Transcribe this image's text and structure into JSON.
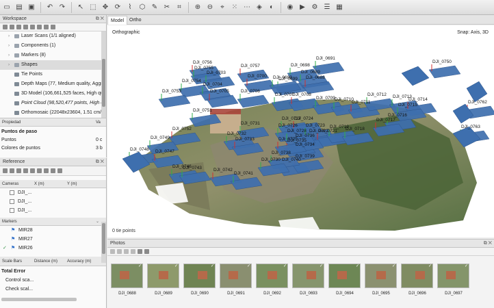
{
  "workspace": {
    "title": "Workspace",
    "tree": [
      {
        "label": "Laser Scans (1/1 aligned)",
        "indent": 0,
        "expandable": true
      },
      {
        "label": "Components (1)",
        "indent": 0,
        "expandable": true
      },
      {
        "label": "Markers (8)",
        "indent": 0,
        "expandable": true
      },
      {
        "label": "Shapes",
        "indent": 0,
        "expandable": true
      },
      {
        "label": "Tie Points",
        "indent": 1,
        "expandable": false
      },
      {
        "label": "Depth Maps (77, Medium quality, Aggres",
        "indent": 1,
        "expandable": false
      },
      {
        "label": "3D Model (106,661,525 faces, High quali",
        "indent": 1,
        "expandable": false
      },
      {
        "label": "Point Cloud (98,520,477 points, High qua",
        "indent": 1,
        "expandable": false
      },
      {
        "label": "Orthomosaic (22048x23604, 1.51 cm/pix",
        "indent": 1,
        "expandable": false
      }
    ]
  },
  "properties": {
    "col_name": "Propiedad",
    "col_value": "Va",
    "section": "Puntos de paso",
    "rows": [
      {
        "name": "Puntos",
        "value": "0 c"
      },
      {
        "name": "Colores de puntos",
        "value": "3 b"
      }
    ]
  },
  "reference": {
    "title": "Reference",
    "cam_columns": [
      "Cameras",
      "X (m)",
      "Y (m)"
    ],
    "cameras": [
      "DJI_...",
      "DJI_...",
      "DJI_..."
    ],
    "markers_header": "Markers",
    "markers": [
      {
        "name": "MIR28",
        "checked": false
      },
      {
        "name": "MIR27",
        "checked": false
      },
      {
        "name": "MIR26",
        "checked": true
      }
    ],
    "scalebar_columns": [
      "Scale Bars",
      "Distance (m)",
      "Accuracy (m)",
      "Er"
    ],
    "total_error": "Total Error",
    "error_rows": [
      "Control sca...",
      "Check scal..."
    ]
  },
  "view": {
    "tabs": [
      "Model",
      "Ortho"
    ],
    "active_tab": "Model",
    "projection": "Orthographic",
    "snap": "Snap: Axis, 3D",
    "status": "0 tie points"
  },
  "scene_labels": [
    "DJI_0756",
    "DJI_0755",
    "DJI_0703",
    "DJI_0757",
    "DJI_0698",
    "DJI_0691",
    "DJI_0750",
    "DJI_0754",
    "DJI_0704",
    "DJI_0700",
    "DJI_0699",
    "DJI_0689",
    "DJI_0688",
    "DJI_0690",
    "DJI_0753",
    "DJI_0705",
    "DJI_0706",
    "DJI_0707",
    "DJI_0708",
    "DJI_0709",
    "DJI_0710",
    "DJI_0711",
    "DJI_0712",
    "DJI_0713",
    "DJI_0714",
    "DJI_0715",
    "DJI_0716",
    "DJI_0762",
    "DJI_0727",
    "DJI_0726",
    "DJI_0724",
    "DJI_0723",
    "DJI_0722",
    "DJI_0721",
    "DJI_0719",
    "DJI_0718",
    "DJI_0717",
    "DJI_0763",
    "DJI_0751",
    "DJI_0752",
    "DJI_0731",
    "DJI_0732",
    "DJI_0733",
    "DJI_0749",
    "DJI_0748",
    "DJI_0747",
    "DJI_0746",
    "DJI_0743",
    "DJI_0742",
    "DJI_0741",
    "DJI_0740",
    "DJI_0739",
    "DJI_0738",
    "DJI_0734",
    "DJI_0735",
    "DJI_0736",
    "DJI_0728",
    "DJI_0725",
    "DJI_0730"
  ],
  "photos": {
    "title": "Photos",
    "items": [
      "DJI_0688",
      "DJI_0689",
      "DJI_0690",
      "DJI_0691",
      "DJI_0692",
      "DJI_0693",
      "DJI_0694",
      "DJI_0695",
      "DJI_0696",
      "DJI_0697"
    ]
  },
  "colors": {
    "camera_plane": "#3e6fae",
    "accent": "#2e6bd0",
    "flag": "#2f6fc9"
  },
  "toolbar_icons": [
    "new-icon",
    "open-icon",
    "save-icon",
    "undo-icon",
    "redo-icon",
    "pointer-icon",
    "select-rect-icon",
    "move-icon",
    "rotate-icon",
    "draw-polyline-icon",
    "draw-polygon-icon",
    "ruler-icon",
    "cut-icon",
    "crop-icon",
    "zoom-in-icon",
    "zoom-out-icon",
    "navigate-icon",
    "grid-icon",
    "points-icon",
    "model-icon",
    "shaded-icon",
    "camera-icon",
    "video-icon",
    "settings-icon",
    "menu-icon",
    "map-icon"
  ]
}
